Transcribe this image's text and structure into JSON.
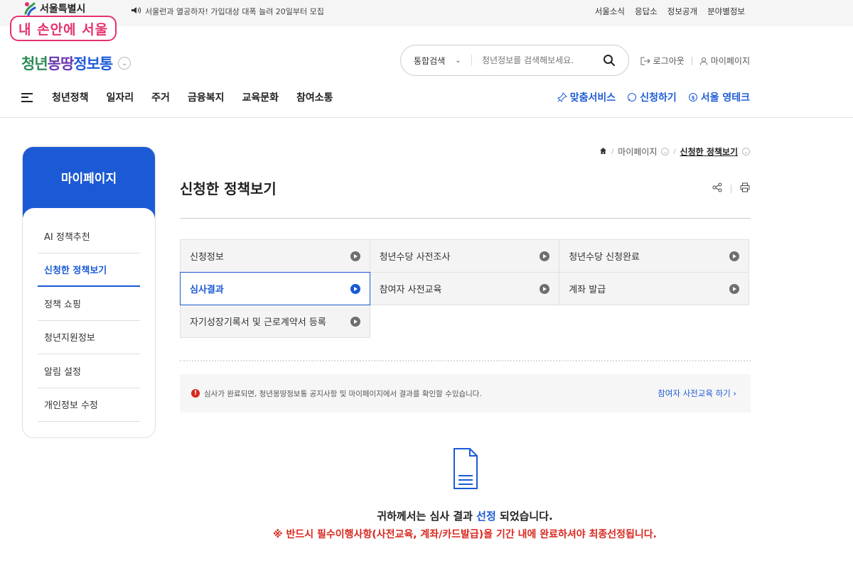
{
  "topbar": {
    "seoul_logo": "서울특별시",
    "notice": "서울런과 열공하자! 가입대상 대폭 늘려 20일부터 모집",
    "links": [
      "서울소식",
      "응답소",
      "정보공개",
      "분야별정보"
    ]
  },
  "stamp": "내 손안에 서울",
  "header": {
    "logo_parts": [
      "청년",
      "몽땅",
      "정보통"
    ],
    "search": {
      "scope": "통합검색",
      "placeholder": "청년정보를 검색해보세요."
    },
    "user_links": {
      "logout": "로그아웃",
      "mypage": "마이페이지"
    },
    "gnb": [
      "청년정책",
      "일자리",
      "주거",
      "금융복지",
      "교육문화",
      "참여소통"
    ],
    "quick_links": {
      "custom": "맞춤서비스",
      "apply": "신청하기",
      "youth_tech": "서울 영테크"
    }
  },
  "side": {
    "title": "마이페이지",
    "items": [
      "AI 정책추천",
      "신청한 정책보기",
      "정책 쇼핑",
      "청년지원정보",
      "알림 설정",
      "개인정보 수정"
    ],
    "active_index": 1
  },
  "breadcrumb": {
    "level1": "마이페이지",
    "current": "신청한 정책보기"
  },
  "page_title": "신청한 정책보기",
  "tabs": {
    "row1": [
      "신청정보",
      "청년수당 사전조사",
      "청년수당 신청완료"
    ],
    "row2": [
      "심사결과",
      "참여자 사전교육",
      "계좌 발급"
    ],
    "row3": [
      "자기성장기록서 및 근로계약서 등록"
    ],
    "active": "심사결과"
  },
  "info": {
    "message": "심사가 완료되면, 청년몽땅정보통 공지사항 및 마이페이지에서 결과를 확인할 수있습니다.",
    "link": "참여자 사전교육 하기 ›"
  },
  "result": {
    "line1_before": "귀하께서는 심사 결과",
    "line1_highlight": "선정",
    "line1_after": "되었습니다.",
    "line2": "※ 반드시 필수이행사항(사전교육, 계좌/카드발급)을 기간 내에 완료하셔야 최종선정됩니다."
  },
  "colors": {
    "primary": "#1c5ad5",
    "warning": "#d8281f",
    "stamp": "#e5326f"
  }
}
